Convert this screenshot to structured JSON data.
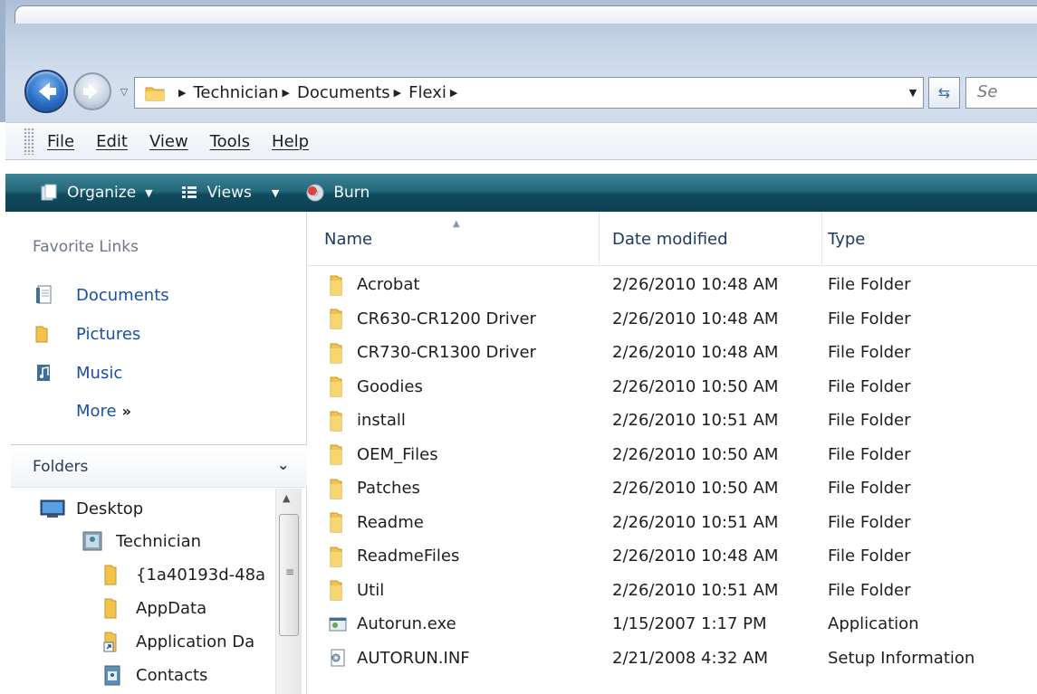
{
  "address": {
    "crumbs": [
      "Technician",
      "Documents",
      "Flexi"
    ],
    "search_placeholder": "Se"
  },
  "menu": {
    "items": [
      "File",
      "Edit",
      "View",
      "Tools",
      "Help"
    ]
  },
  "command_bar": {
    "organize": "Organize",
    "views": "Views",
    "burn": "Burn"
  },
  "nav": {
    "favorite_links_title": "Favorite Links",
    "favorites": [
      "Documents",
      "Pictures",
      "Music"
    ],
    "more_label": "More",
    "more_chevron": "»",
    "folders_title": "Folders",
    "tree": [
      "Desktop",
      "Technician",
      "{1a40193d-48a",
      "AppData",
      "Application Da",
      "Contacts"
    ]
  },
  "file_list": {
    "columns": [
      "Name",
      "Date modified",
      "Type"
    ],
    "rows": [
      {
        "name": "Acrobat",
        "date": "2/26/2010 10:48 AM",
        "type": "File Folder",
        "icon": "folder-icon"
      },
      {
        "name": "CR630-CR1200 Driver",
        "date": "2/26/2010 10:48 AM",
        "type": "File Folder",
        "icon": "folder-icon"
      },
      {
        "name": "CR730-CR1300 Driver",
        "date": "2/26/2010 10:48 AM",
        "type": "File Folder",
        "icon": "folder-icon"
      },
      {
        "name": "Goodies",
        "date": "2/26/2010 10:50 AM",
        "type": "File Folder",
        "icon": "folder-icon"
      },
      {
        "name": "install",
        "date": "2/26/2010 10:51 AM",
        "type": "File Folder",
        "icon": "folder-icon"
      },
      {
        "name": "OEM_Files",
        "date": "2/26/2010 10:50 AM",
        "type": "File Folder",
        "icon": "folder-icon"
      },
      {
        "name": "Patches",
        "date": "2/26/2010 10:50 AM",
        "type": "File Folder",
        "icon": "folder-icon"
      },
      {
        "name": "Readme",
        "date": "2/26/2010 10:51 AM",
        "type": "File Folder",
        "icon": "folder-icon"
      },
      {
        "name": "ReadmeFiles",
        "date": "2/26/2010 10:48 AM",
        "type": "File Folder",
        "icon": "folder-icon"
      },
      {
        "name": "Util",
        "date": "2/26/2010 10:51 AM",
        "type": "File Folder",
        "icon": "folder-icon"
      },
      {
        "name": "Autorun.exe",
        "date": "1/15/2007 1:17 PM",
        "type": "Application",
        "icon": "application-icon"
      },
      {
        "name": "AUTORUN.INF",
        "date": "2/21/2008 4:32 AM",
        "type": "Setup Information",
        "icon": "setup-info-icon"
      }
    ]
  },
  "colors": {
    "link_blue": "#1c4fa3",
    "command_bar_teal": "#1b5a6d",
    "folder_yellow": "#f2c34a"
  }
}
